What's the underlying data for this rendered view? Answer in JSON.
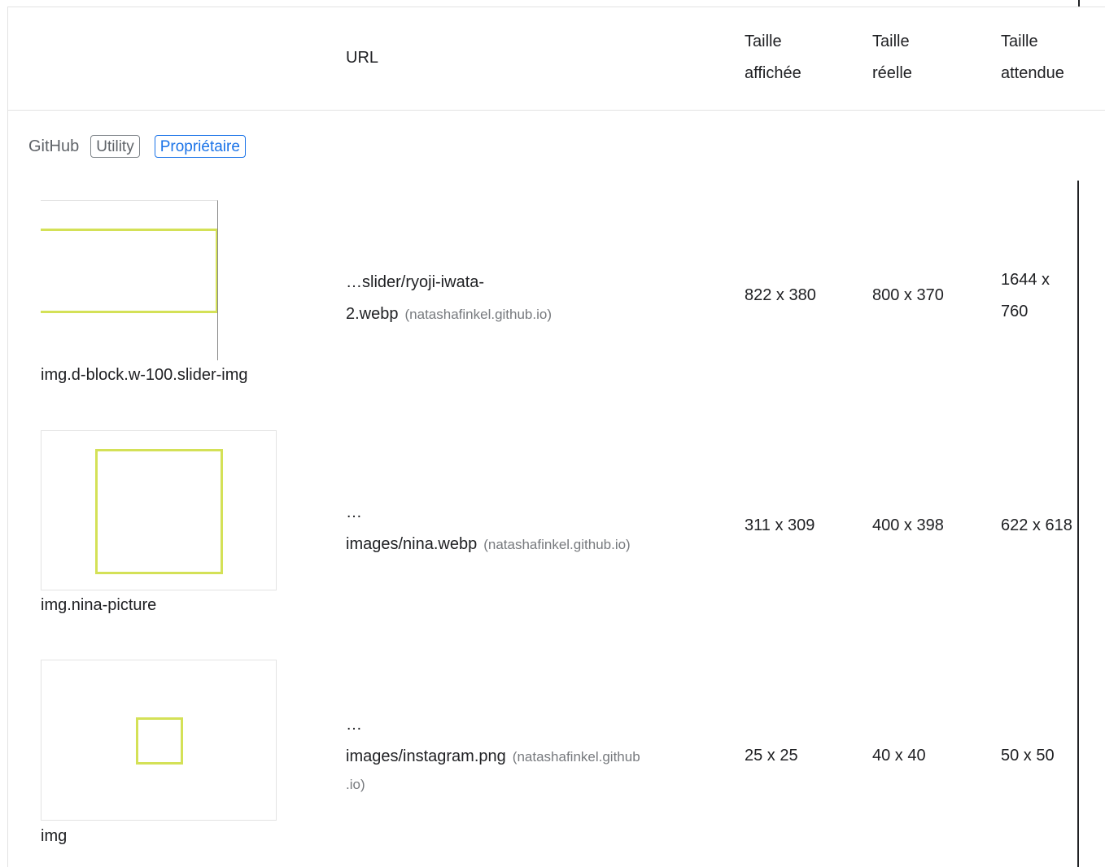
{
  "header": {
    "url_label": "URL",
    "displayed_size": [
      "Taille",
      "affichée"
    ],
    "actual_size": [
      "Taille",
      "réelle"
    ],
    "expected_size": [
      "Taille",
      "attendue"
    ]
  },
  "group": {
    "name": "GitHub",
    "badges": [
      "Utility",
      "Propriétaire"
    ]
  },
  "rows": [
    {
      "selector": "img.d-block.w-100.slider-img",
      "url_lines": [
        "…slider/ryoji-iwata-",
        "2.webp"
      ],
      "host": "(natashafinkel.github.io)",
      "displayed": "822 x 380",
      "actual": "800 x 370",
      "expected_lines": [
        "1644 x",
        "760"
      ]
    },
    {
      "selector": "img.nina-picture",
      "url_lines": [
        "…",
        "images/nina.webp"
      ],
      "host": "(natashafinkel.github.io)",
      "displayed": "311 x 309",
      "actual": "400 x 398",
      "expected": "622 x 618"
    },
    {
      "selector": "img",
      "url_lines": [
        "…",
        "images/instagram.png"
      ],
      "host_lines": [
        "(natashafinkel.github",
        ".io)"
      ],
      "displayed": "25 x 25",
      "actual": "40 x 40",
      "expected": "50 x 50"
    }
  ],
  "colors": {
    "highlight": "#d4e157",
    "border": "#e3e3e3",
    "badge_blue": "#1a73e8"
  }
}
